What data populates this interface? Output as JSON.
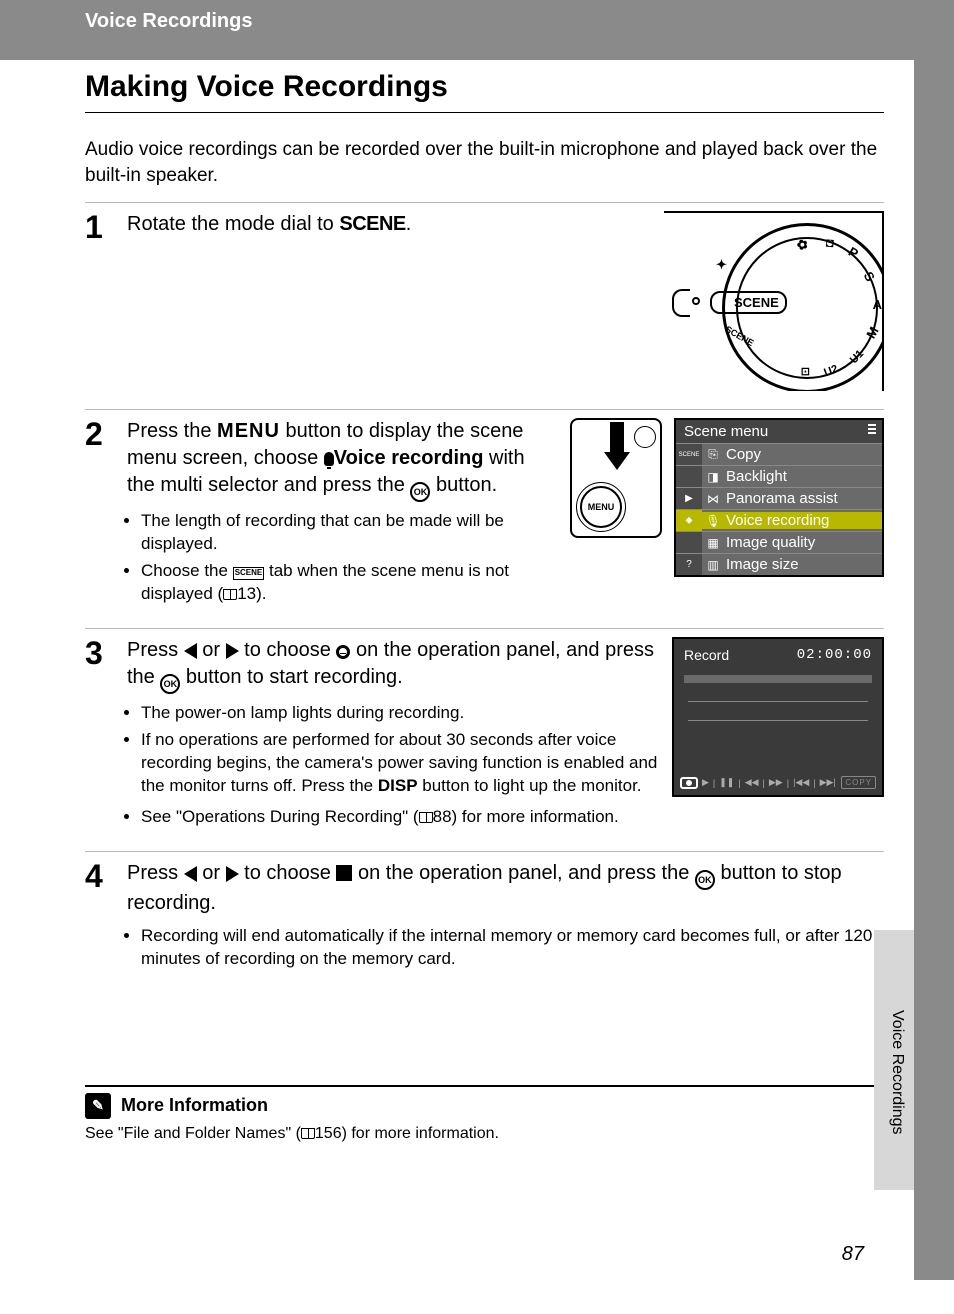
{
  "chapter": "Voice Recordings",
  "title": "Making Voice Recordings",
  "intro": "Audio voice recordings can be recorded over the built-in microphone and played back over the built-in speaker.",
  "page_number": "87",
  "side_label": "Voice Recordings",
  "steps": {
    "s1": {
      "num": "1",
      "text_a": "Rotate the mode dial to ",
      "text_b": "."
    },
    "s2": {
      "num": "2",
      "text_a": "Press the ",
      "text_b": " button to display the scene menu screen, choose ",
      "text_c": "Voice recording",
      "text_d": " with the multi selector and press the ",
      "text_e": " button.",
      "b1": "The length of recording that can be made will be displayed.",
      "b2a": "Choose the ",
      "b2b": " tab when the scene menu is not displayed (",
      "b2c": "13)."
    },
    "s3": {
      "num": "3",
      "text_a": "Press ",
      "text_b": " or ",
      "text_c": " to choose ",
      "text_d": " on the operation panel, and press the ",
      "text_e": " button to start recording.",
      "b1": "The power-on lamp lights during recording.",
      "b2a": "If no operations are performed for about 30 seconds after voice recording begins, the camera's power saving function is enabled and the monitor turns off. Press the ",
      "b2b": " button to light up the monitor.",
      "b3a": "See \"Operations During Recording\" (",
      "b3b": "88) for more information."
    },
    "s4": {
      "num": "4",
      "text_a": "Press ",
      "text_b": " or ",
      "text_c": " to choose ",
      "text_d": " on the operation panel, and press the ",
      "text_e": " button to stop recording.",
      "b1": "Recording will end automatically if the internal memory or memory card becomes full, or after 120 minutes of recording on the memory card."
    }
  },
  "dial": {
    "scene": "SCENE"
  },
  "menu_btn": "MENU",
  "scene_menu": {
    "title": "Scene menu",
    "items": [
      {
        "side": "SCENE",
        "icon": "⎘",
        "label": "Copy"
      },
      {
        "side": "",
        "icon": "◐",
        "label": "Backlight"
      },
      {
        "side": "▶",
        "icon": "⋈",
        "label": "Panorama assist"
      },
      {
        "side": "🎤",
        "icon": "🎙",
        "label": "Voice recording",
        "selected": true
      },
      {
        "side": "",
        "icon": "▦",
        "label": "Image quality"
      },
      {
        "side": "?",
        "icon": "▥",
        "label": "Image size"
      }
    ]
  },
  "record": {
    "label": "Record",
    "time": "02:00:00",
    "copy": "COPY"
  },
  "more_info": {
    "heading": "More Information",
    "body_a": "See \"File and Folder Names\" (",
    "body_b": "156) for more information."
  }
}
